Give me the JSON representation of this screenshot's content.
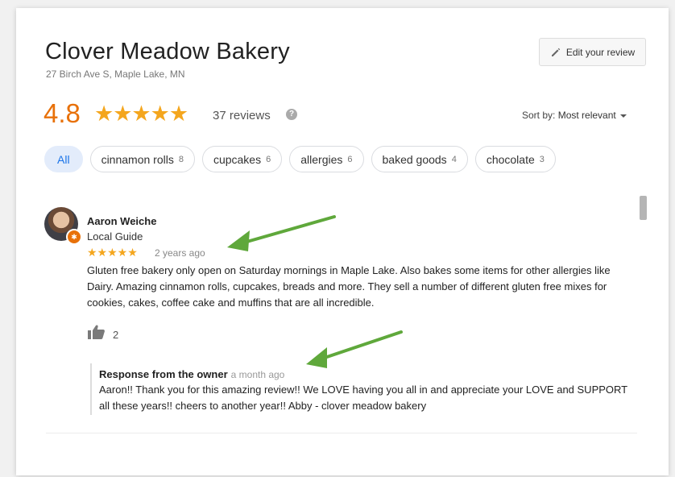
{
  "business": {
    "name": "Clover Meadow Bakery",
    "address": "27 Birch Ave S, Maple Lake, MN",
    "rating": "4.8",
    "stars": "★★★★★",
    "review_count": "37 reviews",
    "rating_value": 4.8
  },
  "edit_review": {
    "label": "Edit your review"
  },
  "sort": {
    "label": "Sort by:",
    "value": "Most relevant"
  },
  "filters": [
    {
      "label": "All",
      "count": ""
    },
    {
      "label": "cinnamon rolls",
      "count": "8"
    },
    {
      "label": "cupcakes",
      "count": "6"
    },
    {
      "label": "allergies",
      "count": "6"
    },
    {
      "label": "baked goods",
      "count": "4"
    },
    {
      "label": "chocolate",
      "count": "3"
    }
  ],
  "review": {
    "author": "Aaron Weiche",
    "badge": "Local Guide",
    "stars": "★★★★★",
    "time": "2 years ago",
    "text": "Gluten free bakery only open on Saturday mornings in Maple Lake. Also bakes some items for other allergies like Dairy.  Amazing cinnamon rolls, cupcakes, breads and more.  They sell a number of different gluten free mixes for cookies, cakes, coffee cake and muffins that are all incredible.",
    "likes": "2"
  },
  "owner_response": {
    "heading": "Response from the owner",
    "time": "a month ago",
    "text": "Aaron!! Thank you for this amazing review!! We LOVE having you all in and appreciate your LOVE and SUPPORT all these years!! cheers to another year!! Abby - clover meadow bakery"
  },
  "colors": {
    "rating_orange": "#e8710a",
    "star_gold": "#f4a61e",
    "chip_active_bg": "#e3ecfb",
    "chip_active_text": "#1a73e8",
    "arrow_green": "#5fa83b"
  },
  "icons": {
    "edit": "pencil-icon",
    "help": "question-icon",
    "like": "thumbs-up-icon",
    "sort": "caret-down-icon"
  }
}
